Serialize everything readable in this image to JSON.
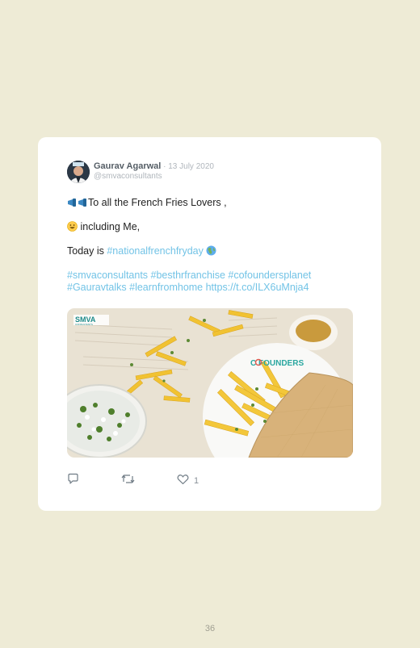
{
  "tweet": {
    "author_name": "Gaurav Agarwal",
    "date_sep": " · ",
    "date": "13 July 2020",
    "handle": "@smvaconsultants",
    "line1_text": "To all the French Fries Lovers ,",
    "line2_text": " including Me,",
    "line3_prefix": "Today is ",
    "line3_hashtag": "#nationalfrenchfryday",
    "hashtags_line1": "#smvaconsultants #besthrfranchise #cofoundersplanet",
    "hashtags_line2": "#Gauravtalks #learnfromhome ",
    "link": "https://t.co/ILX6uMnja4",
    "media_logo_text": "SMVA",
    "media_logo_sub": "CONSULTANTS",
    "media_brand_text": "C FOUNDERS",
    "like_count": "1"
  },
  "icons": {
    "line1": "megaphone-icon",
    "line2": "grinning-face-icon",
    "line3": "globe-icon",
    "reply": "reply-icon",
    "retweet": "retweet-icon",
    "like": "heart-icon"
  },
  "colors": {
    "page_background": "#eeebd6",
    "card": "#ffffff",
    "hashtag": "#72c3e6",
    "author": "#555e66",
    "meta": "#b0b6bc"
  },
  "page": {
    "number": "36"
  }
}
